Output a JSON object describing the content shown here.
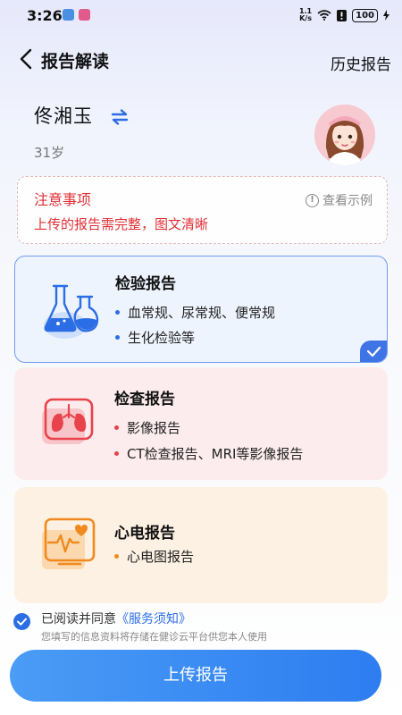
{
  "status_bar": {
    "time": "3:26",
    "net_speed_value": "1.1",
    "net_speed_unit": "K/s",
    "battery": "100"
  },
  "header": {
    "title": "报告解读",
    "history_label": "历史报告"
  },
  "patient": {
    "name": "佟湘玉",
    "age": "31岁"
  },
  "notice": {
    "title": "注意事项",
    "text": "上传的报告需完整，图文清晰",
    "example_label": "查看示例"
  },
  "cards": [
    {
      "title": "检验报告",
      "items": [
        "血常规、尿常规、便常规",
        "生化检验等"
      ],
      "selected": true
    },
    {
      "title": "检查报告",
      "items": [
        "影像报告",
        "CT检查报告、MRI等影像报告"
      ],
      "selected": false
    },
    {
      "title": "心电报告",
      "items": [
        "心电图报告"
      ],
      "selected": false
    }
  ],
  "agreement": {
    "checked": true,
    "prefix": "已阅读并同意",
    "link": "《服务须知》",
    "note": "您填写的信息资料将存储在健诊云平台供您本人使用"
  },
  "upload_button": "上传报告",
  "colors": {
    "primary": "#2b6de5",
    "warning": "#e22f33",
    "exam_accent": "#e8424a",
    "ecg_accent": "#f08a1f"
  }
}
